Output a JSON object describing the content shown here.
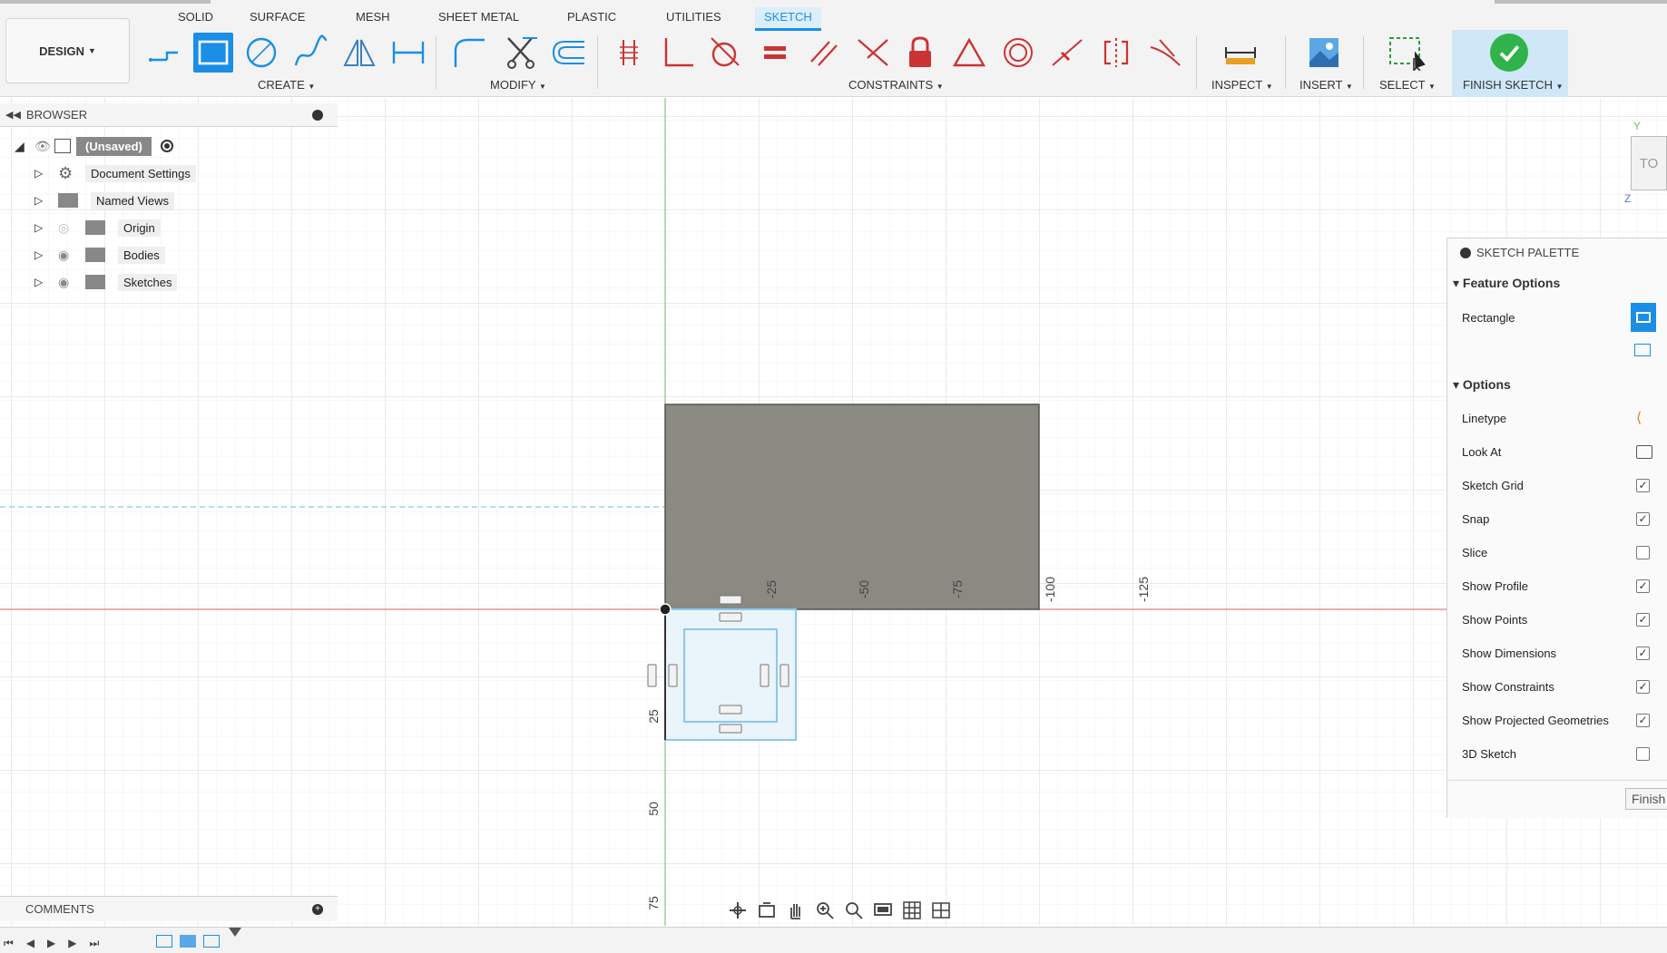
{
  "tabs": [
    {
      "label": "SOLID"
    },
    {
      "label": "SURFACE"
    },
    {
      "label": "MESH"
    },
    {
      "label": "SHEET METAL"
    },
    {
      "label": "PLASTIC"
    },
    {
      "label": "UTILITIES"
    },
    {
      "label": "SKETCH",
      "active": true
    }
  ],
  "workspace": {
    "label": "DESIGN"
  },
  "toolbar_groups": {
    "create": "CREATE",
    "modify": "MODIFY",
    "constraints": "CONSTRAINTS",
    "inspect": "INSPECT",
    "insert": "INSERT",
    "select": "SELECT",
    "finish": "FINISH SKETCH"
  },
  "browser": {
    "title": "BROWSER",
    "root": "(Unsaved)",
    "items": [
      {
        "label": "Document Settings",
        "icon": "gear-icon"
      },
      {
        "label": "Named Views",
        "icon": "folder-icon"
      },
      {
        "label": "Origin",
        "icon": "folder-icon",
        "hidden": true
      },
      {
        "label": "Bodies",
        "icon": "folder-icon"
      },
      {
        "label": "Sketches",
        "icon": "folder-icon"
      }
    ]
  },
  "palette": {
    "title": "SKETCH PALETTE",
    "feature_options_title": "Feature Options",
    "rectangle_label": "Rectangle",
    "options_title": "Options",
    "options": [
      {
        "label": "Linetype",
        "type": "icon"
      },
      {
        "label": "Look At",
        "type": "icon"
      },
      {
        "label": "Sketch Grid",
        "checked": true
      },
      {
        "label": "Snap",
        "checked": true
      },
      {
        "label": "Slice",
        "checked": false
      },
      {
        "label": "Show Profile",
        "checked": true
      },
      {
        "label": "Show Points",
        "checked": true
      },
      {
        "label": "Show Dimensions",
        "checked": true
      },
      {
        "label": "Show Constraints",
        "checked": true
      },
      {
        "label": "Show Projected Geometries",
        "checked": true
      },
      {
        "label": "3D Sketch",
        "checked": false
      }
    ],
    "finish_label": "Finish"
  },
  "canvas": {
    "x_ticks": [
      "-25",
      "-50",
      "-75",
      "-100",
      "-125"
    ],
    "y_ticks": [
      "25",
      "50",
      "75"
    ]
  },
  "viewcube": {
    "face": "TO",
    "axis_y": "Y",
    "axis_z": "Z"
  },
  "comments": {
    "title": "COMMENTS"
  },
  "colors": {
    "accent": "#1b8ee6",
    "body_fill": "#8a8a82",
    "x_axis": "#e08080",
    "y_axis": "#7bc87b"
  }
}
